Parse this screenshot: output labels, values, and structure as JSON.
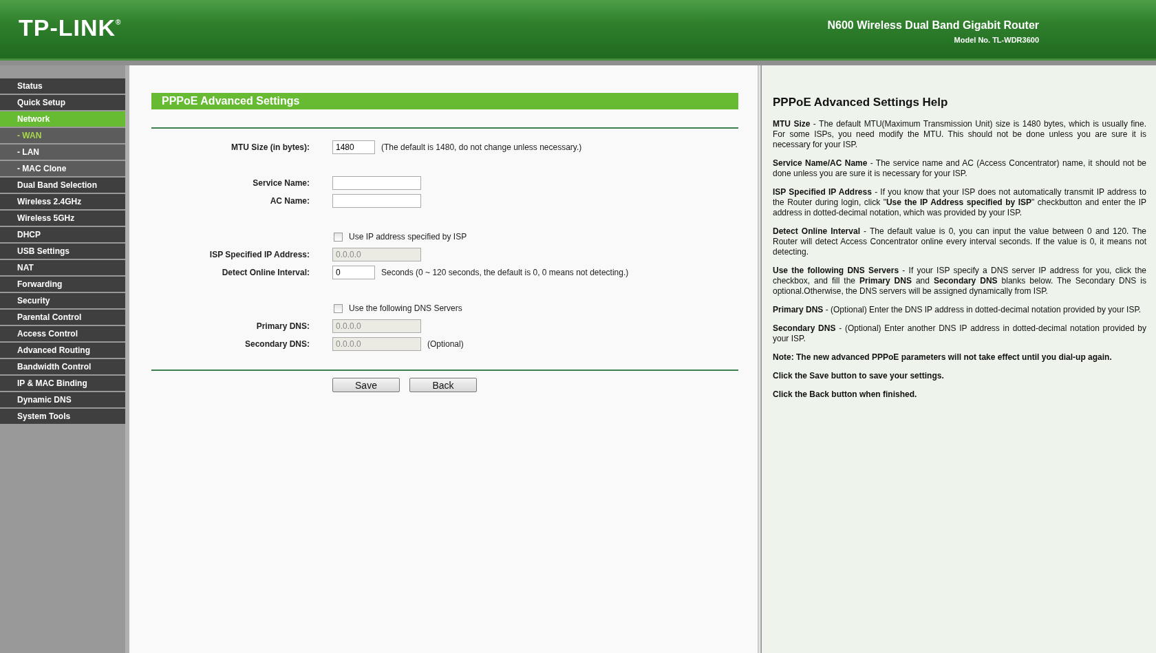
{
  "header": {
    "logo": "TP-LINK",
    "logo_mark": "®",
    "product": "N600 Wireless Dual Band Gigabit Router",
    "model": "Model No. TL-WDR3600"
  },
  "sidebar": {
    "items": [
      {
        "label": "Status",
        "kind": "main",
        "selected": false
      },
      {
        "label": "Quick Setup",
        "kind": "main",
        "selected": false
      },
      {
        "label": "Network",
        "kind": "main",
        "selected": true
      },
      {
        "label": "- WAN",
        "kind": "sub",
        "selected": true
      },
      {
        "label": "- LAN",
        "kind": "sub",
        "selected": false
      },
      {
        "label": "- MAC Clone",
        "kind": "sub",
        "selected": false
      },
      {
        "label": "Dual Band Selection",
        "kind": "main",
        "selected": false
      },
      {
        "label": "Wireless 2.4GHz",
        "kind": "main",
        "selected": false
      },
      {
        "label": "Wireless 5GHz",
        "kind": "main",
        "selected": false
      },
      {
        "label": "DHCP",
        "kind": "main",
        "selected": false
      },
      {
        "label": "USB Settings",
        "kind": "main",
        "selected": false
      },
      {
        "label": "NAT",
        "kind": "main",
        "selected": false
      },
      {
        "label": "Forwarding",
        "kind": "main",
        "selected": false
      },
      {
        "label": "Security",
        "kind": "main",
        "selected": false
      },
      {
        "label": "Parental Control",
        "kind": "main",
        "selected": false
      },
      {
        "label": "Access Control",
        "kind": "main",
        "selected": false
      },
      {
        "label": "Advanced Routing",
        "kind": "main",
        "selected": false
      },
      {
        "label": "Bandwidth Control",
        "kind": "main",
        "selected": false
      },
      {
        "label": "IP & MAC Binding",
        "kind": "main",
        "selected": false
      },
      {
        "label": "Dynamic DNS",
        "kind": "main",
        "selected": false
      },
      {
        "label": "System Tools",
        "kind": "main",
        "selected": false
      }
    ]
  },
  "form": {
    "title": "PPPoE Advanced Settings",
    "sections": [
      [
        {
          "kind": "input",
          "label": "MTU Size (in bytes):",
          "value": "1480",
          "short": true,
          "disabled": false,
          "note": "(The default is 1480, do not change unless necessary.)"
        }
      ],
      [
        {
          "kind": "input",
          "label": "Service Name:",
          "short": false,
          "disabled": false
        },
        {
          "kind": "input",
          "label": "AC Name:",
          "short": false,
          "disabled": false
        }
      ],
      [
        {
          "kind": "checkbox",
          "label": "Use IP address specified by ISP",
          "checked": false
        },
        {
          "kind": "input",
          "label": "ISP Specified IP Address:",
          "value": "0.0.0.0",
          "short": false,
          "disabled": true
        },
        {
          "kind": "input",
          "label": "Detect Online Interval:",
          "value": "0",
          "short": true,
          "disabled": false,
          "note": "Seconds (0 ~ 120 seconds, the default is 0, 0 means not detecting.)"
        }
      ],
      [
        {
          "kind": "checkbox",
          "label": "Use the following DNS Servers",
          "checked": false
        },
        {
          "kind": "input",
          "label": "Primary DNS:",
          "value": "0.0.0.0",
          "short": false,
          "disabled": true
        },
        {
          "kind": "input",
          "label": "Secondary DNS:",
          "value": "0.0.0.0",
          "short": false,
          "disabled": true,
          "note": "(Optional)"
        }
      ]
    ],
    "buttons": [
      "Save",
      "Back"
    ]
  },
  "help": {
    "title": "PPPoE Advanced Settings Help",
    "paragraphs": [
      {
        "text": "**MTU Size** - The default MTU(Maximum Transmission Unit) size is 1480 bytes, which is usually fine. For some ISPs, you need modify the MTU. This should not be done unless you are sure it is necessary for your ISP.",
        "bold": false
      },
      {
        "text": "**Service Name/AC Name** - The service name and AC (Access Concentrator) name, it should not be done unless you are sure it is necessary for your ISP.",
        "bold": false
      },
      {
        "text": "**ISP Specified IP Address** - If you know that your ISP does not automatically transmit IP address to the Router during login, click \"**Use the IP Address specified by ISP**\" checkbutton and enter the IP address in dotted-decimal notation, which was provided by your ISP.",
        "bold": false
      },
      {
        "text": "**Detect Online Interval** - The default value is 0, you can input the value between 0 and 120. The Router will detect Access Concentrator online every interval seconds. If the value is 0, it means not detecting.",
        "bold": false
      },
      {
        "text": "**Use the following DNS Servers** - If your ISP specify a DNS server IP address for you, click the checkbox, and fill the **Primary DNS** and **Secondary DNS** blanks below. The Secondary DNS is optional.Otherwise, the DNS servers will be assigned dynamically from ISP.",
        "bold": false
      },
      {
        "text": "**Primary DNS** - (Optional) Enter the DNS IP address in dotted-decimal notation provided by your ISP.",
        "bold": false
      },
      {
        "text": "**Secondary DNS** - (Optional) Enter another DNS IP address in dotted-decimal notation provided by your ISP.",
        "bold": false
      },
      {
        "text": "Note: The new advanced PPPoE parameters will not take effect until you dial-up again.",
        "bold": true
      },
      {
        "text": "Click the Save button to save your settings.",
        "bold": true
      },
      {
        "text": "Click the Back button when finished.",
        "bold": true
      }
    ]
  }
}
